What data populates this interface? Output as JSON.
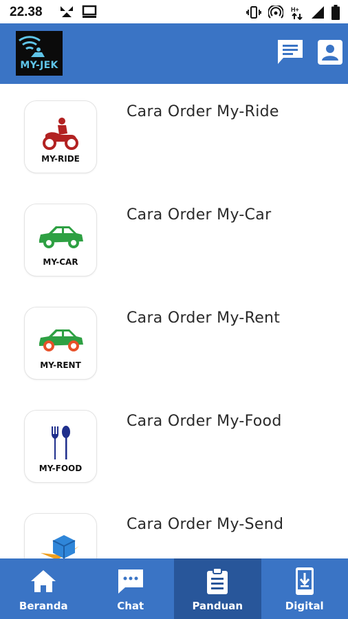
{
  "status_bar": {
    "time": "22.38",
    "icons": [
      "cursor-app-icon",
      "cast-icon",
      "vibrate-icon",
      "hotspot-icon",
      "data-arrows-icon",
      "signal-icon",
      "battery-icon"
    ]
  },
  "header": {
    "logo_text": "MY-JEK",
    "actions": [
      "message-icon",
      "account-icon"
    ],
    "colors": {
      "bar": "#3a74c5",
      "logo_bg": "#0b0b0b",
      "logo_text": "#5fc4e8"
    }
  },
  "guides": [
    {
      "title": "Cara Order My-Ride",
      "label": "MY-RIDE",
      "icon": "motorbike-icon",
      "color": "#b22222"
    },
    {
      "title": "Cara Order My-Car",
      "label": "MY-CAR",
      "icon": "car-icon",
      "color": "#2ea043"
    },
    {
      "title": "Cara Order My-Rent",
      "label": "MY-RENT",
      "icon": "rent-car-icon",
      "color": "#2ea043"
    },
    {
      "title": "Cara Order My-Food",
      "label": "MY-FOOD",
      "icon": "fork-spoon-icon",
      "color": "#1f2f8c"
    },
    {
      "title": "Cara Order My-Send",
      "label": "",
      "icon": "package-icon",
      "color": "#f0a020"
    }
  ],
  "bottom_nav": {
    "items": [
      {
        "label": "Beranda",
        "icon": "home-icon"
      },
      {
        "label": "Chat",
        "icon": "chat-icon"
      },
      {
        "label": "Panduan",
        "icon": "clipboard-icon",
        "active": true
      },
      {
        "label": "Digital",
        "icon": "phone-download-icon"
      }
    ],
    "colors": {
      "bar": "#3a74c5",
      "active": "#28569a"
    }
  }
}
